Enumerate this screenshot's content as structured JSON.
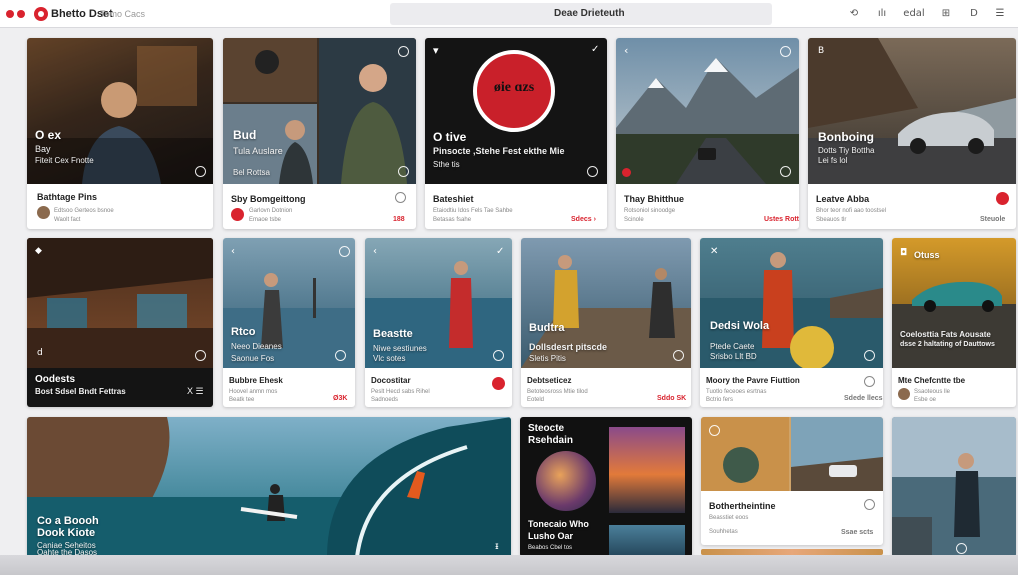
{
  "app": {
    "name": "Bhetto Dset",
    "nav_link": "Tomo Cacs",
    "window_title": "Deae Drieteuth",
    "toolbar": [
      "⟲",
      "ılı",
      "edal",
      "⊞",
      "D",
      "☰"
    ]
  },
  "row1": [
    {
      "overlay_title": "O ex",
      "overlay_sub1": "Bay",
      "overlay_sub2": "Fiteit Cex   Fnotte",
      "title": "Bathtage Pins",
      "meta1": "Edtsoo Gerteos bsnoe",
      "meta2": "Waolt fact"
    },
    {
      "overlay_title": "Bud",
      "overlay_sub1": "Tula Auslare",
      "overlay_sub2": "Bel Rottsa",
      "title": "Sby Bomgeittong",
      "meta1": "Garlovn Dotnion",
      "meta2": "Emaoe tsbe",
      "num": "188"
    },
    {
      "logo_text": "øie ɑzs",
      "overlay_title": "O tive",
      "overlay_sub1": "Pinsocte ,Stehe Fest ekthe Mie",
      "overlay_sub2": "Sthe tis",
      "title": "Bateshiet",
      "meta1": "Etaiodtiu Idos Fels Tae Sahbe",
      "meta2": "Betasas fsahe",
      "num": "Sdecs ›"
    },
    {
      "title": "Thay Bhitthue",
      "meta1": "Rotsoniol sinoodge",
      "meta2": "Scinole",
      "num": "Ustes Rott"
    },
    {
      "overlay_title": "Bonboing",
      "overlay_sub1": "Dotts Tiy Bottha",
      "overlay_sub2": "Lei fs lol",
      "title": "Leatve Abba",
      "meta1": "Bhor teor nofi aao toostsel",
      "meta2": "Sbeauos tlr",
      "num": "Steuole"
    }
  ],
  "row2": [
    {
      "overlay_title": "Oodests",
      "overlay_sub1": "Bost Sdsel Bndt Fettras",
      "controls": "X ☰"
    },
    {
      "overlay_title": "Rtco",
      "overlay_sub1": "Neeo Dieanes",
      "overlay_sub2": "Saonue Fos",
      "title": "Bubbre Ehesk",
      "meta1": "Hoovel anmn mos",
      "meta2": "Beatk tee",
      "num": "Ø3K"
    },
    {
      "overlay_title": "Beastte",
      "overlay_sub1": "Niwe sestiunes",
      "overlay_sub2": "Vlc sotes",
      "title": "Docostitar",
      "meta1": "Peslt Hecd sabs Rihel",
      "meta2": "Sadnoeds"
    },
    {
      "overlay_title": "Budtra",
      "overlay_sub1": "Dollsdesrt pitscde",
      "overlay_sub2": "Sletis Pitis",
      "title": "Debtseticez",
      "meta1": "Betoteosross Mtie tilod",
      "meta2": "Eoteld",
      "num": "Sddo SK"
    },
    {
      "overlay_title": "Dedsi Wola",
      "overlay_sub1": "Ptede Caete",
      "overlay_sub2": "Srisbo Llt BD",
      "title": "Moory the Pavre Fiuttion",
      "meta1": "Tuotlo feceoes esrtnas",
      "meta2": "Bctrio fers",
      "num": "Sdede llecs"
    },
    {
      "overlay_title": "Otuss",
      "overlay_sub1": "Coelosttia Fats Aousate",
      "overlay_sub2": "dsse 2 haltating of Dauttows",
      "title": "Mte Chefcntte tbe",
      "meta1": "Ssaoteous lle",
      "meta2": "Esbe oe"
    }
  ],
  "row3": [
    {
      "overlay_title": "Co a Boooh",
      "overlay_sub1": "Dook Kiote",
      "overlay_sub2": "Caniae Seheitos",
      "overlay_sub3": "Oahte the Dasos"
    },
    {
      "overlay_title": "Steocte",
      "overlay_sub1": "Rsehdain",
      "overlay_sub2": "Tonecaio Who",
      "overlay_sub3": "Lusho Oar",
      "overlay_sub4": "Beabos Cbel tos"
    },
    {
      "title": "Bothertheintine",
      "meta1": "Beasstiet eoos",
      "meta2": "Souhhetas",
      "num": "Ssae scts"
    }
  ],
  "colors": {
    "accent": "#d9232e",
    "background": "#efeff1",
    "card": "#ffffff"
  }
}
